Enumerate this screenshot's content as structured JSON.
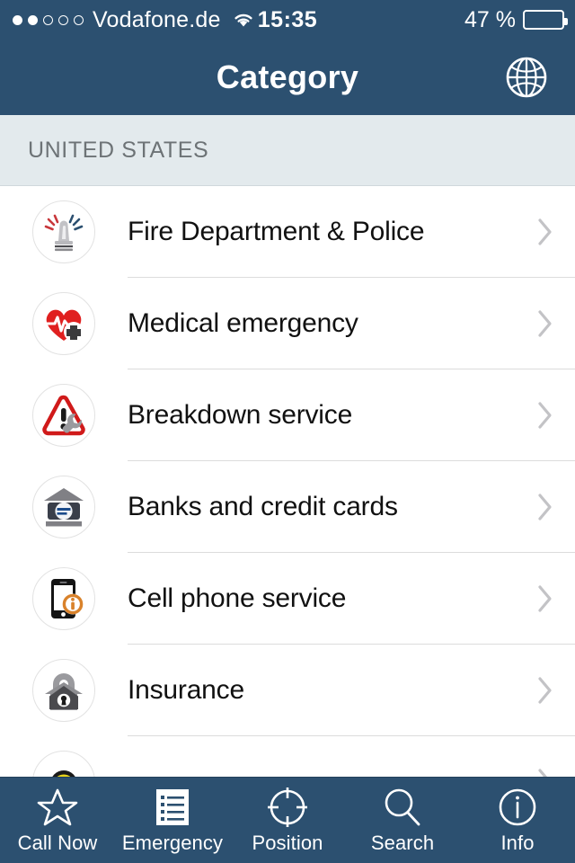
{
  "status_bar": {
    "signal_dots_total": 5,
    "signal_dots_filled": 2,
    "carrier": "Vodafone.de",
    "wifi_icon": "wifi-icon",
    "time": "15:35",
    "battery_percent_label": "47 %",
    "battery_level": 47
  },
  "nav_bar": {
    "title": "Category",
    "right_icon": "globe-icon",
    "background_color": "#2c5070"
  },
  "section": {
    "header": "UNITED STATES",
    "header_background": "#e3eaed"
  },
  "list": {
    "chevron_icon": "chevron-right-icon",
    "items": [
      {
        "label": "Fire Department & Police",
        "icon": "siren-icon",
        "icon_colors": [
          "#c8373b",
          "#2c5070",
          "#b0b0b4"
        ]
      },
      {
        "label": "Medical emergency",
        "icon": "heart-pulse-cross-icon",
        "icon_colors": [
          "#e02020",
          "#3a3a3c"
        ]
      },
      {
        "label": "Breakdown service",
        "icon": "warning-triangle-wrench-icon",
        "icon_colors": [
          "#d01a1a",
          "#9a9a9e"
        ]
      },
      {
        "label": "Banks and credit cards",
        "icon": "bank-credit-card-icon",
        "icon_colors": [
          "#7d7d81",
          "#3a3a4a",
          "#1a4a8a"
        ]
      },
      {
        "label": "Cell phone service",
        "icon": "phone-info-icon",
        "icon_colors": [
          "#141414",
          "#d9822b"
        ]
      },
      {
        "label": "Insurance",
        "icon": "house-lock-icon",
        "icon_colors": [
          "#9a9a9e",
          "#4a4a4e"
        ]
      },
      {
        "label": "",
        "icon": "taxi-icon",
        "icon_colors": [
          "#e8d41a",
          "#1a1a1a"
        ],
        "partially_visible": true
      }
    ]
  },
  "tab_bar": {
    "background_color": "#2c5070",
    "selected_index": 1,
    "tabs": [
      {
        "label": "Call Now",
        "icon": "star-icon"
      },
      {
        "label": "Emergency",
        "icon": "list-document-icon"
      },
      {
        "label": "Position",
        "icon": "crosshair-icon"
      },
      {
        "label": "Search",
        "icon": "magnifier-icon"
      },
      {
        "label": "Info",
        "icon": "info-circle-icon"
      }
    ]
  }
}
